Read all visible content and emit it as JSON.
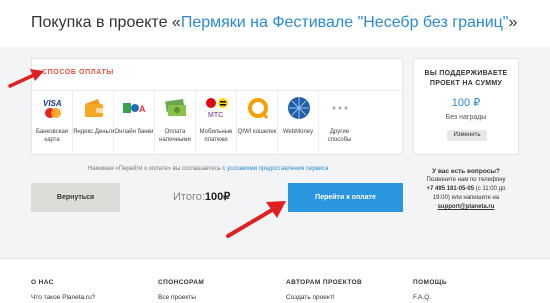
{
  "header": {
    "prefix": "Покупка в проекте «",
    "project_link": "Пермяки на Фестивале \"Несебр без границ\"",
    "suffix": "»"
  },
  "payment": {
    "heading": "СПОСОБ ОПЛАТЫ",
    "methods": [
      {
        "label": "Банковская карта",
        "icon": "visa-mastercard-icon"
      },
      {
        "label": "Яндекс.Деньги",
        "icon": "yandex-money-icon"
      },
      {
        "label": "Онлайн банки",
        "icon": "online-banks-icon"
      },
      {
        "label": "Оплата наличными",
        "icon": "cash-icon"
      },
      {
        "label": "Мобильные платежи",
        "icon": "mobile-operators-icon"
      },
      {
        "label": "QIWI кошелек",
        "icon": "qiwi-icon"
      },
      {
        "label": "WebMoney",
        "icon": "webmoney-icon"
      },
      {
        "label": "Другие способы",
        "icon": "more-dots-icon"
      }
    ]
  },
  "support": {
    "heading_line1": "ВЫ ПОДДЕРЖИВАЕТЕ",
    "heading_line2": "ПРОЕКТ НА СУММУ",
    "amount": "100 ₽",
    "reward": "Без награды",
    "change_label": "Изменить"
  },
  "terms": {
    "text": "Нажимая «Перейти к оплате» вы соглашаетесь с ",
    "link": "условиями предоставления сервиса"
  },
  "actions": {
    "back_label": "Вернуться",
    "total_label": "Итого:",
    "total_value": "100₽",
    "pay_label": "Перейти к оплате"
  },
  "help": {
    "question": "У вас есть вопросы?",
    "line1": "Позвоните нам по телефону",
    "phone": "+7 495 181-05-05",
    "line2": " (с 11:00 до",
    "line3": "19:00) или напишите на",
    "email": "support@planeta.ru"
  },
  "footer": {
    "columns": [
      {
        "heading": "О НАС",
        "link": "Что такое Planeta.ru?"
      },
      {
        "heading": "СПОНСОРАМ",
        "link": "Все проекты"
      },
      {
        "heading": "АВТОРАМ ПРОЕКТОВ",
        "link": "Создать проект!"
      },
      {
        "heading": "ПОМОЩЬ",
        "link": "F.A.Q."
      }
    ]
  },
  "colors": {
    "accent": "#2a96e0",
    "link": "#2a8bd4",
    "heading_red": "#e7533c",
    "arrow": "#e02020"
  }
}
